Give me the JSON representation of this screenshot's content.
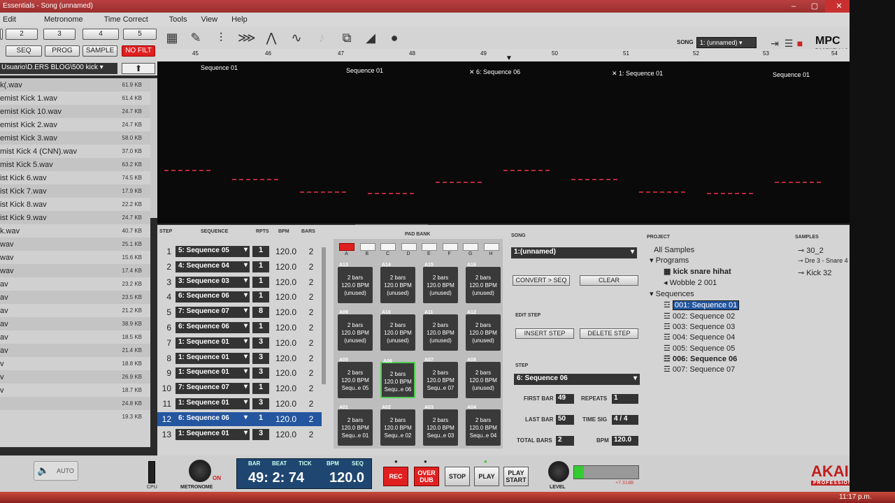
{
  "title": "Essentials - Song (unnamed)",
  "menu": [
    "Edit",
    "Metronome",
    "Time Correct",
    "Tools",
    "View",
    "Help"
  ],
  "toolbar": {
    "nums": [
      "2",
      "3",
      "4",
      "5"
    ],
    "modes": [
      "SEQ",
      "PROG",
      "SAMPLE"
    ],
    "nofilt": "NO FILT",
    "song_label": "SONG",
    "song_value": "1: (unnamed)",
    "logo": "MPC",
    "logo_sub": "ESSENTIALS"
  },
  "browser": {
    "path": "Usuario\\D.ERS BLOG\\500 kick",
    "files": [
      {
        "name": "k(.wav",
        "size": "61.9 KB"
      },
      {
        "name": "emist Kick 1.wav",
        "size": "61.4 KB"
      },
      {
        "name": "emist Kick 10.wav",
        "size": "24.7 KB"
      },
      {
        "name": "emist Kick 2.wav",
        "size": "24.7 KB"
      },
      {
        "name": "emist Kick 3.wav",
        "size": "58.0 KB"
      },
      {
        "name": "mist Kick 4 (CNN).wav",
        "size": "37.0 KB"
      },
      {
        "name": "mist Kick 5.wav",
        "size": "63.2 KB"
      },
      {
        "name": "ist Kick 6.wav",
        "size": "74.5 KB"
      },
      {
        "name": "ist Kick 7.wav",
        "size": "17.9 KB"
      },
      {
        "name": "ist Kick 8.wav",
        "size": "22.2 KB"
      },
      {
        "name": "ist Kick 9.wav",
        "size": "24.7 KB"
      },
      {
        "name": "k.wav",
        "size": "40.7 KB"
      },
      {
        "name": "wav",
        "size": "25.1 KB"
      },
      {
        "name": "wav",
        "size": "15.6 KB"
      },
      {
        "name": "wav",
        "size": "17.4 KB"
      },
      {
        "name": "av",
        "size": "23.2 KB"
      },
      {
        "name": "av",
        "size": "23.5 KB"
      },
      {
        "name": "av",
        "size": "21.2 KB"
      },
      {
        "name": "av",
        "size": "38.9 KB"
      },
      {
        "name": "av",
        "size": "18.5 KB"
      },
      {
        "name": "av",
        "size": "21.4 KB"
      },
      {
        "name": "v",
        "size": "18.8 KB"
      },
      {
        "name": "v",
        "size": "26.9 KB"
      },
      {
        "name": "v",
        "size": "18.7 KB"
      },
      {
        "name": "",
        "size": "24.8 KB"
      },
      {
        "name": "",
        "size": "19.3 KB"
      }
    ]
  },
  "timeline": {
    "ruler": [
      "45",
      "46",
      "47",
      "48",
      "49",
      "50",
      "51",
      "52",
      "53",
      "54"
    ],
    "labels": [
      "Sequence 01",
      "Sequence 01",
      "6: Sequence 06",
      "1: Sequence 01",
      "Sequence 01"
    ]
  },
  "steps": {
    "headers": {
      "step": "STEP",
      "sequence": "SEQUENCE",
      "rpts": "RPTS",
      "bpm": "BPM",
      "bars": "BARS"
    },
    "rows": [
      {
        "n": "1",
        "seq": "5: Sequence 05",
        "r": "1",
        "bpm": "120.0",
        "bars": "2"
      },
      {
        "n": "2",
        "seq": "4: Sequence 04",
        "r": "1",
        "bpm": "120.0",
        "bars": "2"
      },
      {
        "n": "3",
        "seq": "3: Sequence 03",
        "r": "1",
        "bpm": "120.0",
        "bars": "2"
      },
      {
        "n": "4",
        "seq": "6: Sequence 06",
        "r": "1",
        "bpm": "120.0",
        "bars": "2"
      },
      {
        "n": "5",
        "seq": "7: Sequence 07",
        "r": "8",
        "bpm": "120.0",
        "bars": "2"
      },
      {
        "n": "6",
        "seq": "6: Sequence 06",
        "r": "1",
        "bpm": "120.0",
        "bars": "2"
      },
      {
        "n": "7",
        "seq": "1: Sequence 01",
        "r": "3",
        "bpm": "120.0",
        "bars": "2"
      },
      {
        "n": "8",
        "seq": "1: Sequence 01",
        "r": "3",
        "bpm": "120.0",
        "bars": "2"
      },
      {
        "n": "9",
        "seq": "1: Sequence 01",
        "r": "3",
        "bpm": "120.0",
        "bars": "2"
      },
      {
        "n": "10",
        "seq": "7: Sequence 07",
        "r": "1",
        "bpm": "120.0",
        "bars": "2"
      },
      {
        "n": "11",
        "seq": "1: Sequence 01",
        "r": "3",
        "bpm": "120.0",
        "bars": "2"
      },
      {
        "n": "12",
        "seq": "6: Sequence 06",
        "r": "1",
        "bpm": "120.0",
        "bars": "2"
      },
      {
        "n": "13",
        "seq": "1: Sequence 01",
        "r": "3",
        "bpm": "120.0",
        "bars": "2"
      }
    ]
  },
  "padbank": {
    "title": "PAD BANK",
    "banks": [
      "A",
      "B",
      "C",
      "D",
      "E",
      "F",
      "G",
      "H"
    ],
    "pads": [
      {
        "tag": "A13",
        "l1": "2 bars",
        "l2": "120.0 BPM",
        "l3": "(unused)"
      },
      {
        "tag": "A14",
        "l1": "2 bars",
        "l2": "120.0 BPM",
        "l3": "(unused)"
      },
      {
        "tag": "A15",
        "l1": "2 bars",
        "l2": "120.0 BPM",
        "l3": "(unused)"
      },
      {
        "tag": "A16",
        "l1": "2 bars",
        "l2": "120.0 BPM",
        "l3": "(unused)"
      },
      {
        "tag": "A09",
        "l1": "2 bars",
        "l2": "120.0 BPM",
        "l3": "(unused)"
      },
      {
        "tag": "A10",
        "l1": "2 bars",
        "l2": "120.0 BPM",
        "l3": "(unused)"
      },
      {
        "tag": "A11",
        "l1": "2 bars",
        "l2": "120.0 BPM",
        "l3": "(unused)"
      },
      {
        "tag": "A12",
        "l1": "2 bars",
        "l2": "120.0 BPM",
        "l3": "(unused)"
      },
      {
        "tag": "A05",
        "l1": "2 bars",
        "l2": "120.0 BPM",
        "l3": "Sequ..e 05"
      },
      {
        "tag": "A06",
        "l1": "2 bars",
        "l2": "120.0 BPM",
        "l3": "Sequ..e 06"
      },
      {
        "tag": "A07",
        "l1": "2 bars",
        "l2": "120.0 BPM",
        "l3": "Sequ..e 07"
      },
      {
        "tag": "A08",
        "l1": "2 bars",
        "l2": "120.0 BPM",
        "l3": "(unused)"
      },
      {
        "tag": "A01",
        "l1": "2 bars",
        "l2": "120.0 BPM",
        "l3": "Sequ..e 01"
      },
      {
        "tag": "A02",
        "l1": "2 bars",
        "l2": "120.0 BPM",
        "l3": "Sequ..e 02"
      },
      {
        "tag": "A03",
        "l1": "2 bars",
        "l2": "120.0 BPM",
        "l3": "Sequ..e 03"
      },
      {
        "tag": "A04",
        "l1": "2 bars",
        "l2": "120.0 BPM",
        "l3": "Sequ..e 04"
      }
    ]
  },
  "song": {
    "title": "SONG",
    "value": "1:(unnamed)",
    "convert": "CONVERT > SEQ",
    "clear": "CLEAR",
    "edit_step": "EDIT STEP",
    "insert": "INSERT STEP",
    "delete": "DELETE STEP",
    "step_title": "STEP",
    "step_value": "6: Sequence 06",
    "first_bar_l": "FIRST BAR",
    "first_bar": "49",
    "repeats_l": "REPEATS",
    "repeats": "1",
    "last_bar_l": "LAST BAR",
    "last_bar": "50",
    "timesig_l": "TIME SIG",
    "timesig": "4 / 4",
    "total_l": "TOTAL BARS",
    "total": "2",
    "bpm_l": "BPM",
    "bpm": "120.0"
  },
  "project": {
    "title": "PROJECT",
    "items": [
      "All Samples",
      "Programs",
      "kick snare hihat",
      "Wobble 2 001",
      "Sequences",
      "001: Sequence 01",
      "002: Sequence 02",
      "003: Sequence 03",
      "004: Sequence 04",
      "005: Sequence 05",
      "006: Sequence 06",
      "007: Sequence 07"
    ]
  },
  "samples": {
    "title": "SAMPLES",
    "items": [
      "30_2",
      "Dre 3 - Snare 4",
      "Kick 32"
    ]
  },
  "transport": {
    "auto": "AUTO",
    "cpu": "CPU",
    "metronome": "METRONOME",
    "on": "ON",
    "bar_l": "BAR",
    "beat_l": "BEAT",
    "tick_l": "TICK",
    "bpm_l": "BPM",
    "seq_l": "SEQ",
    "position": "49: 2: 74",
    "bpm": "120.0",
    "rec": "REC",
    "overdub": "OVER DUB",
    "stop": "STOP",
    "play": "PLAY",
    "playstart": "PLAY START",
    "level": "LEVEL",
    "db": "+7.31dB",
    "brand": "AKAI",
    "brand_sub": "PROFESSIONAL"
  },
  "clock": "11:17 p.m."
}
